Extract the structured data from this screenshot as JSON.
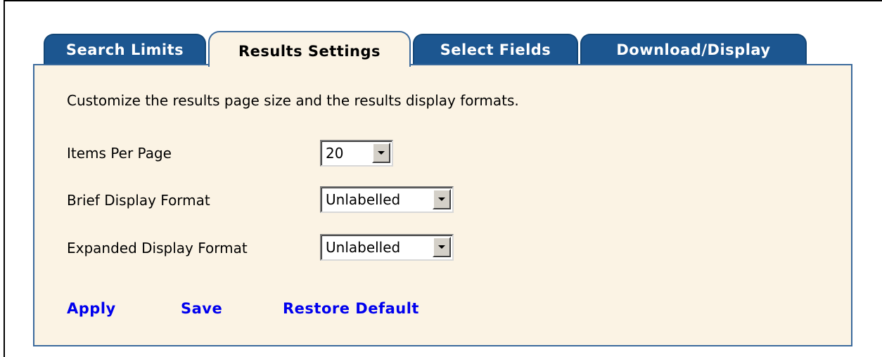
{
  "tabs": [
    {
      "label": "Search Limits",
      "active": false
    },
    {
      "label": "Results Settings",
      "active": true
    },
    {
      "label": "Select Fields",
      "active": false
    },
    {
      "label": "Download/Display",
      "active": false
    }
  ],
  "panel": {
    "intro": "Customize the results page size and the results display formats.",
    "fields": {
      "items_per_page": {
        "label": "Items Per Page",
        "value": "20"
      },
      "brief_display_format": {
        "label": "Brief Display Format",
        "value": "Unlabelled"
      },
      "expanded_display_format": {
        "label": "Expanded Display Format",
        "value": "Unlabelled"
      }
    },
    "actions": {
      "apply": "Apply",
      "save": "Save",
      "restore_default": "Restore Default"
    }
  },
  "colors": {
    "tab_inactive": "#1c5690",
    "panel_background": "#fbf3e4",
    "panel_border": "#3b6a9c",
    "link": "#0000ee"
  },
  "icons": {
    "dropdown_arrow": "chevron-down-icon"
  }
}
